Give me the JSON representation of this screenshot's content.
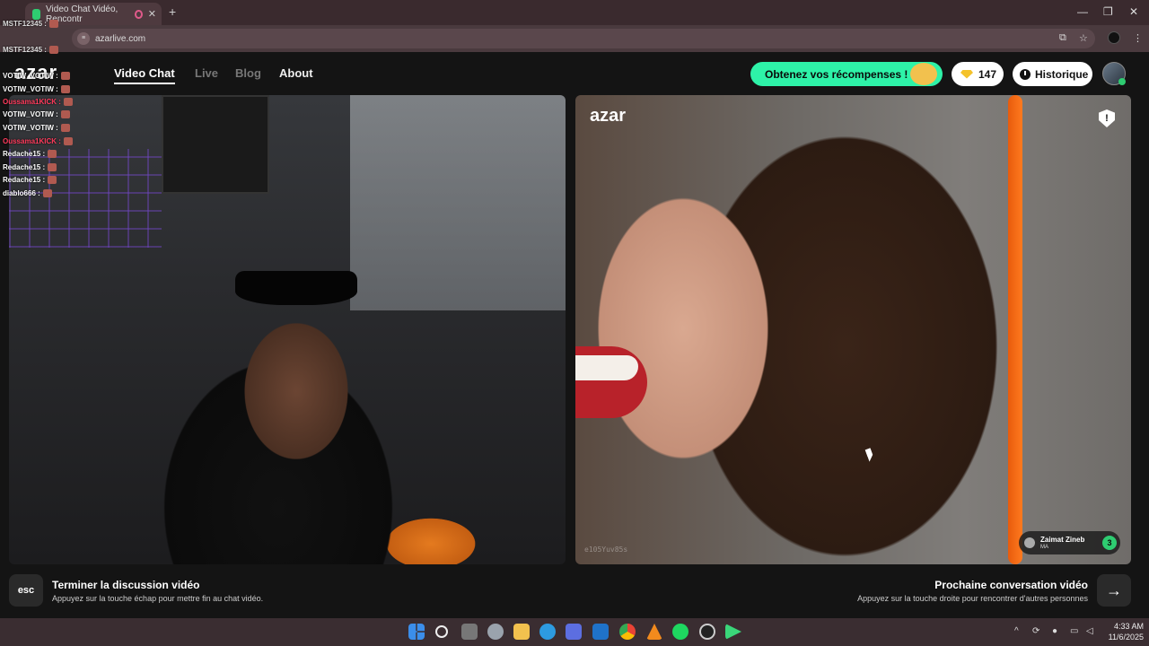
{
  "browser": {
    "tab_title": "Video Chat Vidéo, Rencontr",
    "tab_close": "✕",
    "new_tab": "+",
    "url": "azarlive.com",
    "window_min": "—",
    "window_restore": "❐",
    "window_close": "✕",
    "toolbar_icons": [
      "install-icon",
      "star-icon",
      "profile-icon",
      "menu-icon"
    ]
  },
  "app": {
    "logo": "azar",
    "nav": {
      "video_chat": "Video Chat",
      "live": "Live",
      "blog": "Blog",
      "about": "About"
    },
    "rewards_label": "Obtenez vos récompenses !",
    "gems_count": "147",
    "history_label": "Historique",
    "accent_color": "#2ef2a8"
  },
  "video": {
    "watermark": "azar",
    "report_glyph": "!",
    "peer_id": "e105Yuv85s",
    "peer_name": "Zaimat Zineb",
    "peer_country": "MA",
    "peer_badge": "3"
  },
  "controls": {
    "esc_key": "esc",
    "end_title": "Terminer la discussion vidéo",
    "end_subtitle": "Appuyez sur la touche échap pour mettre fin au chat vidéo.",
    "next_title": "Prochaine conversation vidéo",
    "next_subtitle": "Appuyez sur la touche droite pour rencontrer d'autres personnes",
    "next_arrow": "→"
  },
  "chat_overlay": {
    "messages": [
      {
        "user": "MSTF12345 :",
        "color": "#dddddd"
      },
      {
        "user": "MSTF12345 :",
        "color": "#dddddd"
      },
      {
        "user": "VOTIW_VOTIW :",
        "color": "#ffffff"
      },
      {
        "user": "VOTIW_VOTIW :",
        "color": "#ffffff"
      },
      {
        "user": "Oussama1KICK :",
        "color": "#ff3b5c"
      },
      {
        "user": "VOTIW_VOTIW :",
        "color": "#ffffff"
      },
      {
        "user": "VOTIW_VOTIW :",
        "color": "#ffffff"
      },
      {
        "user": "Oussama1KICK :",
        "color": "#ff3b5c"
      },
      {
        "user": "Redache15 :",
        "color": "#ffffff"
      },
      {
        "user": "Redache15 :",
        "color": "#ffffff"
      },
      {
        "user": "Redache15 :",
        "color": "#ffffff"
      },
      {
        "user": "diablo666 :",
        "color": "#ffffff"
      }
    ]
  },
  "taskbar": {
    "time": "4:33 AM",
    "date": "11/6/2025",
    "icons": [
      "windows-start-icon",
      "search-icon",
      "task-view-icon",
      "settings-icon",
      "file-explorer-icon",
      "edge-icon",
      "store-icon",
      "outlook-icon",
      "chrome-icon",
      "vlc-icon",
      "spotify-icon",
      "obs-icon",
      "media-player-icon"
    ]
  }
}
